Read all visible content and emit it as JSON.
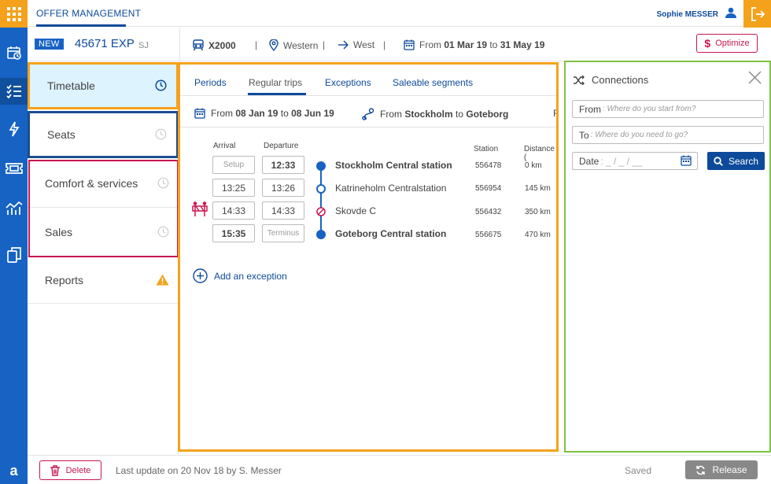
{
  "app": {
    "title": "OFFER MANAGEMENT",
    "user_name": "Sophie MESSER",
    "logo_letter": "a",
    "icons": {
      "apps": "apps-grid-icon",
      "logout": "logout-icon",
      "user": "user-icon",
      "rail": [
        "calendar-icon",
        "checklist-icon",
        "lightning-icon",
        "ticket-icon",
        "chart-icon",
        "copy-icon"
      ]
    },
    "colors": {
      "primary": "#1763c3",
      "accent": "#f4a21c",
      "danger": "#c8174f",
      "success": "#7cc242"
    }
  },
  "offer": {
    "badge": "NEW",
    "name": "45671 EXP",
    "operator": "SJ",
    "train": "X2000",
    "region": "Western",
    "direction": "West",
    "period_from_prefix": "From",
    "period_from": "01 Mar 19",
    "period_to_prefix": "to",
    "period_to": "31 May 19",
    "optimize_label": "Optimize"
  },
  "menu": {
    "items": [
      {
        "label": "Timetable",
        "icon": "clock-icon"
      },
      {
        "label": "Seats",
        "icon": "clock-icon"
      },
      {
        "label": "Comfort & services",
        "icon": "clock-icon"
      },
      {
        "label": "Sales",
        "icon": "clock-icon"
      },
      {
        "label": "Reports",
        "icon": "warning-icon"
      }
    ]
  },
  "timetable": {
    "tabs": [
      "Periods",
      "Regular trips",
      "Exceptions",
      "Saleable segments"
    ],
    "active_tab": "Regular trips",
    "route": {
      "from_prefix": "From",
      "from_date": "08 Jan 19",
      "to_prefix": "to",
      "to_date": "08 Jun 19",
      "origin_prefix": "From",
      "origin": "Stockholm",
      "dest_prefix": "to",
      "destination": "Goteborg",
      "truncated_tail": "Fr"
    },
    "columns": {
      "arrival": "Arrival",
      "departure": "Departure",
      "station": "Station",
      "distance": "Distance ("
    },
    "stops": [
      {
        "arrival": "Setup",
        "departure": "12:33",
        "name": "Stockholm Central station",
        "code": "556478",
        "distance": "0 km"
      },
      {
        "arrival": "13:25",
        "departure": "13:26",
        "name": "Katrineholm Centralstation",
        "code": "556954",
        "distance": "145 km"
      },
      {
        "arrival": "14:33",
        "departure": "14:33",
        "name": "Skovde C",
        "code": "556432",
        "distance": "350 km"
      },
      {
        "arrival": "15:35",
        "departure": "Terminus",
        "name": "Goteborg Central station",
        "code": "556675",
        "distance": "470 km"
      }
    ],
    "add_exception": "Add an exception"
  },
  "connections": {
    "title": "Connections",
    "from_label": "From",
    "from_placeholder": ": Where do you start from?",
    "to_label": "To",
    "to_placeholder": ": Where do you need to go?",
    "date_label": "Date",
    "date_mask": ":  _ / _ / __",
    "search_label": "Search"
  },
  "footer": {
    "delete_label": "Delete",
    "last_update": "Last update on 20 Nov 18 by S. Messer",
    "saved_label": "Saved",
    "release_label": "Release"
  }
}
